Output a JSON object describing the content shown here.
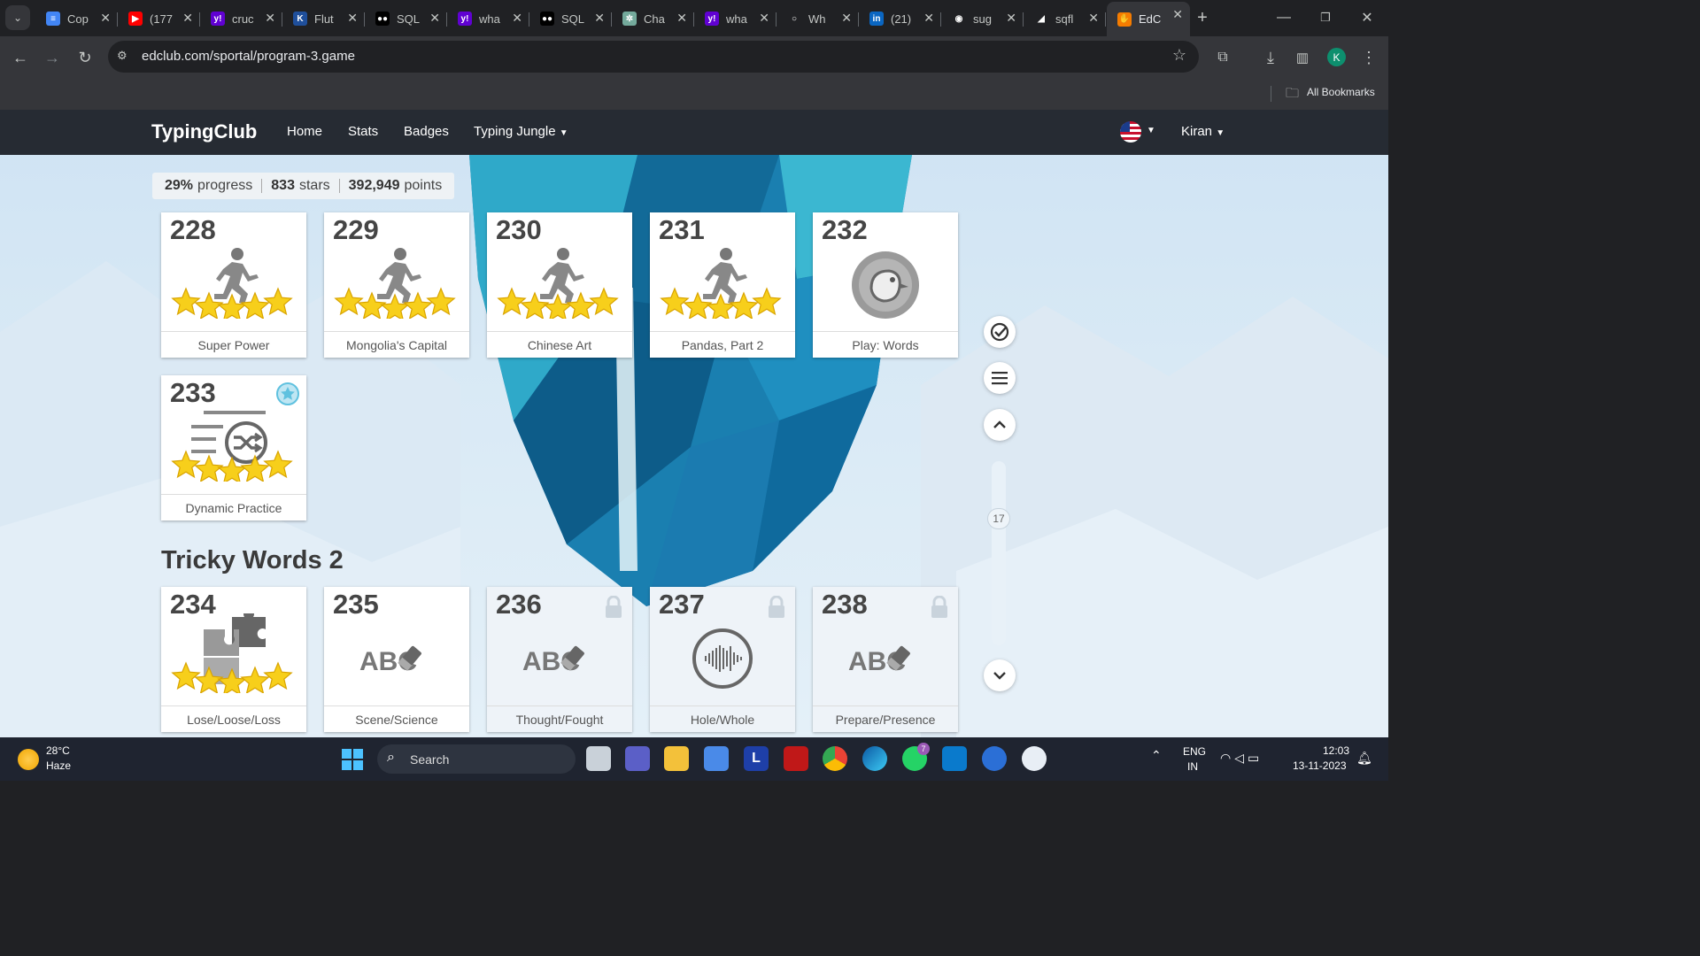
{
  "browser": {
    "tabs": [
      {
        "title": "Cop",
        "color": "#4285f4",
        "glyph": "≡"
      },
      {
        "title": "(177",
        "color": "#ff0000",
        "glyph": "▶"
      },
      {
        "title": "cruc",
        "color": "#6001d2",
        "glyph": "y!"
      },
      {
        "title": "Flut",
        "color": "#1f4f9b",
        "glyph": "K"
      },
      {
        "title": "SQL",
        "color": "#000000",
        "glyph": "●●"
      },
      {
        "title": "wha",
        "color": "#6001d2",
        "glyph": "y!"
      },
      {
        "title": "SQL",
        "color": "#000000",
        "glyph": "●●"
      },
      {
        "title": "Cha",
        "color": "#74aa9c",
        "glyph": "✲"
      },
      {
        "title": "wha",
        "color": "#6001d2",
        "glyph": "y!"
      },
      {
        "title": "Wh",
        "color": "#202124",
        "glyph": "○"
      },
      {
        "title": "(21)",
        "color": "#0a66c2",
        "glyph": "in"
      },
      {
        "title": "sug",
        "color": "#202124",
        "glyph": "◉"
      },
      {
        "title": "sqfl",
        "color": "#202124",
        "glyph": "◢"
      },
      {
        "title": "EdC",
        "color": "#f57c00",
        "glyph": "✋"
      }
    ],
    "url": "edclub.com/sportal/program-3.game",
    "all_bookmarks": "All Bookmarks",
    "profile_initial": "K"
  },
  "site": {
    "brand": "TypingClub",
    "nav": [
      "Home",
      "Stats",
      "Badges",
      "Typing Jungle"
    ],
    "user": "Kiran",
    "stats": {
      "progress": "29%",
      "progress_label": "progress",
      "stars": "833",
      "stars_label": "stars",
      "points": "392,949",
      "points_label": "points"
    },
    "section_title": "Tricky Words 2",
    "scroll_indicator": "17",
    "cards_row1": [
      {
        "num": "228",
        "label": "Super Power",
        "icon": "runner-icon",
        "stars": 5
      },
      {
        "num": "229",
        "label": "Mongolia's Capital",
        "icon": "runner-icon",
        "stars": 5
      },
      {
        "num": "230",
        "label": "Chinese Art",
        "icon": "runner-icon",
        "stars": 5
      },
      {
        "num": "231",
        "label": "Pandas, Part 2",
        "icon": "runner-icon",
        "stars": 5
      },
      {
        "num": "232",
        "label": "Play: Words",
        "icon": "game-bird-icon",
        "stars": 0
      }
    ],
    "cards_row2": [
      {
        "num": "233",
        "label": "Dynamic Practice",
        "icon": "shuffle-icon",
        "stars": 5
      }
    ],
    "cards_row3": [
      {
        "num": "234",
        "label": "Lose/Loose/Loss",
        "icon": "puzzle-icon",
        "stars": 5,
        "locked": false
      },
      {
        "num": "235",
        "label": "Scene/Science",
        "icon": "abc-eraser-icon",
        "stars": 0,
        "locked": false
      },
      {
        "num": "236",
        "label": "Thought/Fought",
        "icon": "abc-eraser-icon",
        "stars": 0,
        "locked": true
      },
      {
        "num": "237",
        "label": "Hole/Whole",
        "icon": "audio-wave-icon",
        "stars": 0,
        "locked": true
      },
      {
        "num": "238",
        "label": "Prepare/Presence",
        "icon": "abc-eraser-icon",
        "stars": 0,
        "locked": true
      }
    ],
    "abc_text": "ABC"
  },
  "taskbar": {
    "weather_temp": "28°C",
    "weather_desc": "Haze",
    "search": "Search",
    "lang1": "ENG",
    "lang2": "IN",
    "time": "12:03",
    "date": "13-11-2023",
    "whatsapp_badge": "7"
  }
}
